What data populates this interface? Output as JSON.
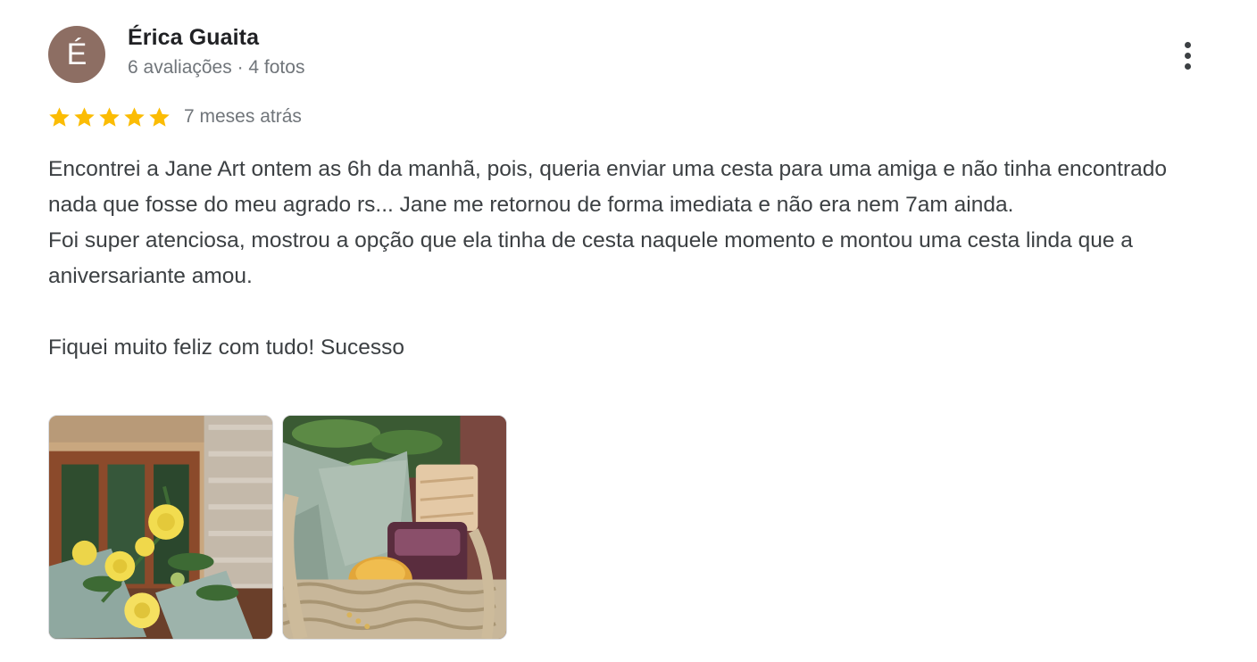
{
  "author": {
    "initial": "É",
    "name": "Érica Guaita",
    "meta": "6 avaliações · 4 fotos",
    "avatar_color": "#8d6e63"
  },
  "menu": {
    "icon": "more-vert-icon"
  },
  "rating": {
    "stars": 5,
    "star_color": "#fbbc04",
    "date": "7 meses atrás"
  },
  "review": {
    "paragraphs": [
      "Encontrei a Jane Art ontem as 6h da manhã, pois, queria enviar uma cesta para uma amiga e não tinha encontrado nada que fosse do meu agrado rs... Jane me retornou de forma imediata e não era nem 7am ainda.",
      "Foi super atenciosa, mostrou a opção que ela tinha de cesta naquele momento e montou uma cesta linda que a aniversariante amou."
    ],
    "closing": "Fiquei muito feliz com tudo! Sucesso"
  },
  "photos": [
    {
      "subject": "yellow-roses-photo"
    },
    {
      "subject": "gift-basket-photo"
    }
  ]
}
